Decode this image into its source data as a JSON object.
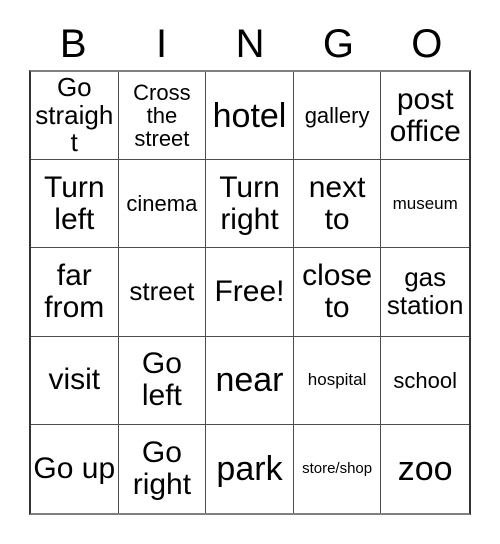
{
  "card": {
    "title": "Bingo Card",
    "header_letters": [
      "B",
      "I",
      "N",
      "G",
      "O"
    ],
    "free_space_label": "Free!",
    "colors": {
      "background": "#ffffff",
      "text": "#000000",
      "grid_line": "#4d4d4d",
      "outer_border": "#333333"
    },
    "rows": [
      [
        {
          "text": "Go straight",
          "size": "md"
        },
        {
          "text": "Cross the street",
          "size": "sm"
        },
        {
          "text": "hotel",
          "size": "xl"
        },
        {
          "text": "gallery",
          "size": "sm"
        },
        {
          "text": "post office",
          "size": "lg"
        }
      ],
      [
        {
          "text": "Turn left",
          "size": "lg"
        },
        {
          "text": "cinema",
          "size": "sm"
        },
        {
          "text": "Turn right",
          "size": "lg"
        },
        {
          "text": "next to",
          "size": "lg"
        },
        {
          "text": "museum",
          "size": "xs"
        }
      ],
      [
        {
          "text": "far from",
          "size": "lg"
        },
        {
          "text": "street",
          "size": "md"
        },
        {
          "text": "Free!",
          "size": "lg"
        },
        {
          "text": "close to",
          "size": "lg"
        },
        {
          "text": "gas station",
          "size": "md"
        }
      ],
      [
        {
          "text": "visit",
          "size": "lg"
        },
        {
          "text": "Go left",
          "size": "lg"
        },
        {
          "text": "near",
          "size": "xl"
        },
        {
          "text": "hospital",
          "size": "xs"
        },
        {
          "text": "school",
          "size": "sm"
        }
      ],
      [
        {
          "text": "Go up",
          "size": "lg"
        },
        {
          "text": "Go right",
          "size": "lg"
        },
        {
          "text": "park",
          "size": "xl"
        },
        {
          "text": "store/shop",
          "size": "xxs"
        },
        {
          "text": "zoo",
          "size": "xl"
        }
      ]
    ]
  }
}
